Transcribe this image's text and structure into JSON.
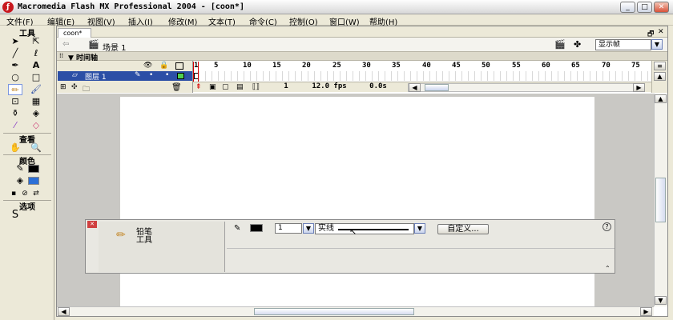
{
  "window": {
    "title": "Macromedia Flash MX Professional 2004 - [coon*]"
  },
  "menu": [
    "文件(F)",
    "编辑(E)",
    "视图(V)",
    "插入(I)",
    "修改(M)",
    "文本(T)",
    "命令(C)",
    "控制(O)",
    "窗口(W)",
    "帮助(H)"
  ],
  "tools": {
    "header": "工具",
    "view_label": "查看",
    "colors_label": "颜色",
    "options_label": "选项"
  },
  "document": {
    "tab": "coon*",
    "scene": "场景 1",
    "view_select": "显示帧"
  },
  "timeline": {
    "title": "▼ 时间轴",
    "layer_name": "图层 1",
    "frame_numbers": [
      "1",
      "5",
      "10",
      "15",
      "20",
      "25",
      "30",
      "35",
      "40",
      "45",
      "50",
      "55",
      "60",
      "65",
      "70",
      "75"
    ],
    "current_frame": "1",
    "fps": "12.0 fps",
    "time": "0.0s"
  },
  "properties": {
    "tool_name": "铅笔\n工具",
    "stroke_height": "1",
    "stroke_style": "实线",
    "custom_button": "自定义..."
  },
  "colors": {
    "accent": "#2c4fa6",
    "stage": "#ffffff",
    "workarea": "#c9c8c4"
  }
}
